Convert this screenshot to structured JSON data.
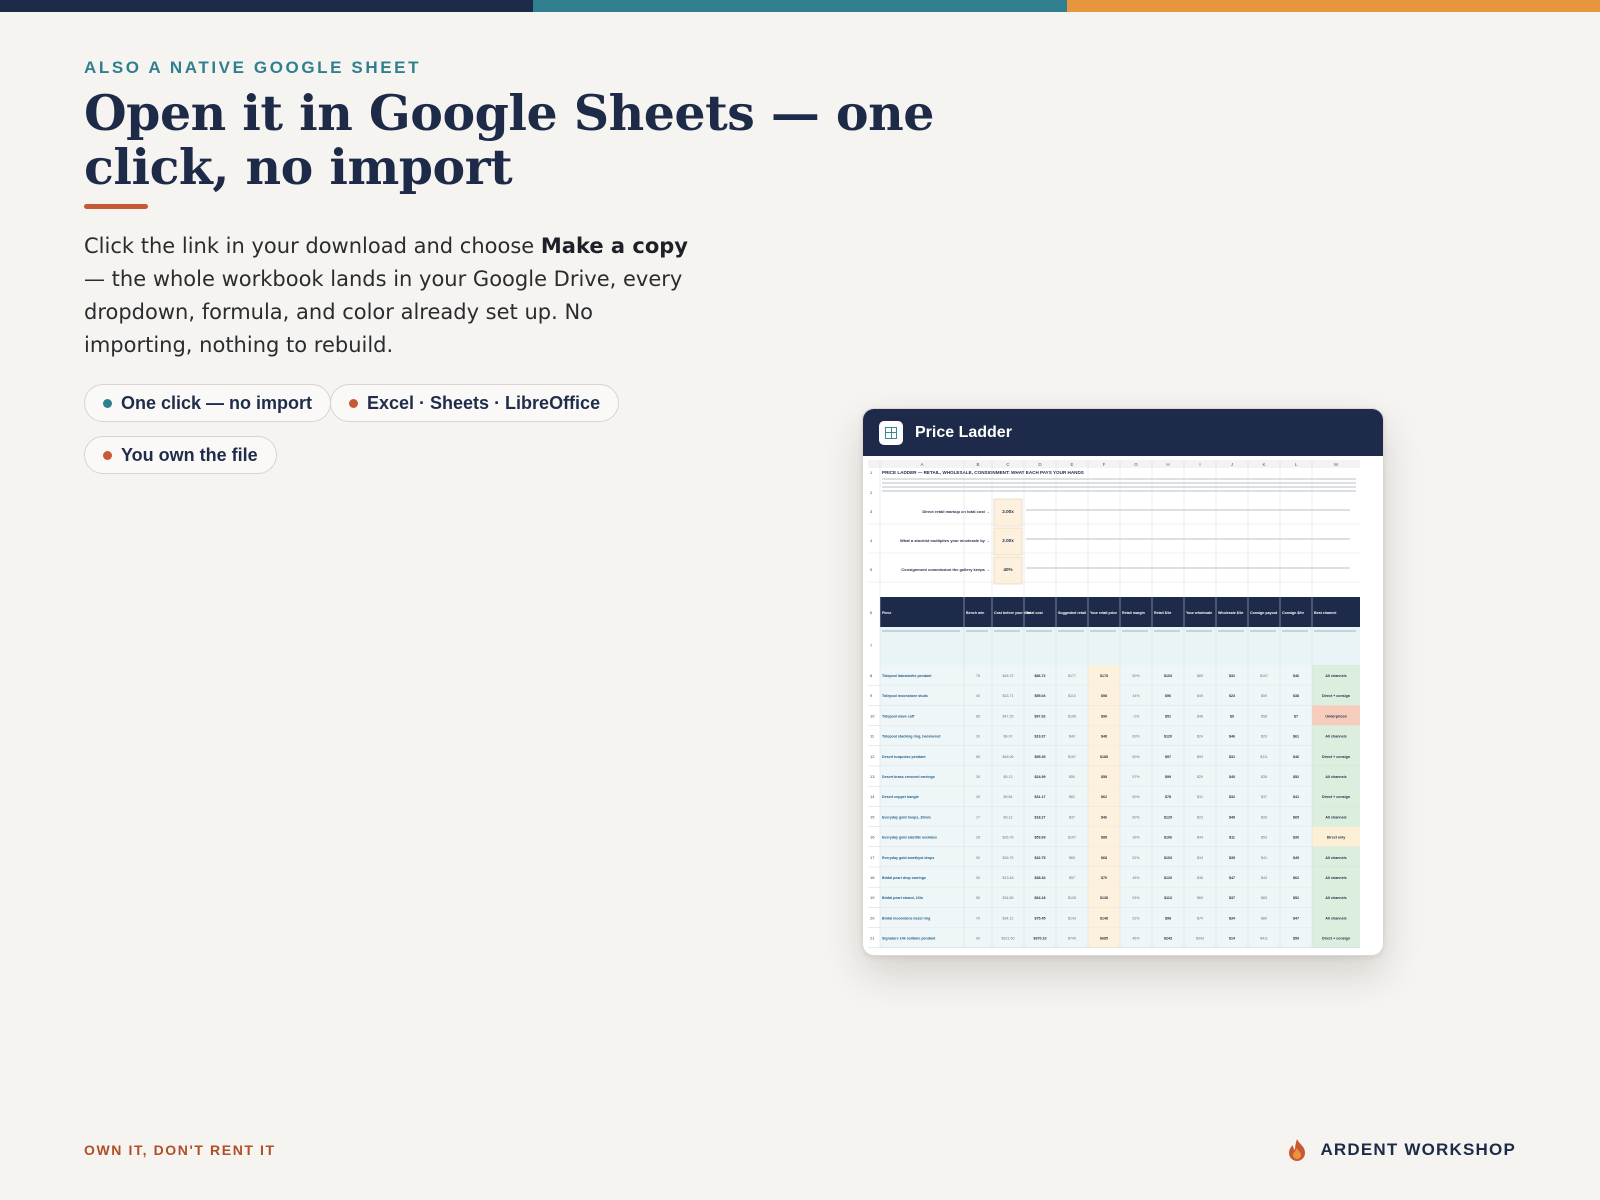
{
  "brand_colors": {
    "navy": "#1e2a4a",
    "teal": "#2f7f8f",
    "orange": "#e8963d",
    "rust": "#c65a35"
  },
  "eyebrow": "ALSO A NATIVE GOOGLE SHEET",
  "headline": "Open it in Google Sheets — one click, no import",
  "body": {
    "part1": "Click the link in your download and choose ",
    "bold": "Make a copy",
    "part2": " — the whole workbook lands in your Google Drive, every dropdown, formula, and color already set up. No importing, nothing to rebuild."
  },
  "pills": [
    {
      "label": "One click — no import",
      "dot_color": "#2f7f8f"
    },
    {
      "label": "Excel · Sheets · LibreOffice",
      "dot_color": "#c65a35"
    },
    {
      "label": "You own the file",
      "dot_color": "#c65a35"
    }
  ],
  "preview": {
    "title": "Price Ladder",
    "icon": "spreadsheet-icon",
    "columns": [
      "A",
      "B",
      "C",
      "D",
      "E",
      "F",
      "G",
      "H",
      "I",
      "J",
      "K",
      "L",
      "M"
    ],
    "sheet_title": "PRICE LADDER — RETAIL, WHOLESALE, CONSIGNMENT: WHAT EACH PAYS YOUR HANDS",
    "settings": [
      {
        "row": "3",
        "label": "Direct retail markup on total cost →",
        "value": "2.00x"
      },
      {
        "row": "4",
        "label": "What a stockist multiplies your wholesale by →",
        "value": "2.00x"
      },
      {
        "row": "5",
        "label": "Consignment commission the gallery keeps →",
        "value": "40%"
      }
    ],
    "headers": [
      "Piece",
      "Bench min",
      "Cost before your time",
      "Total cost",
      "Suggested retail",
      "Your retail price",
      "Retail margin",
      "Retail $/hr",
      "Your wholesale",
      "Wholesale $/hr",
      "Consign payout",
      "Consign $/hr",
      "Best channel"
    ],
    "rows": [
      {
        "n": "8",
        "cells": [
          "Tidepool labradorite pendant",
          "75",
          "$48.72",
          "$86.72",
          "$177",
          "$178",
          "50%",
          "$103",
          "$89",
          "$32",
          "$107",
          "$46",
          "All channels"
        ],
        "status": "good"
      },
      {
        "n": "9",
        "cells": [
          "Tidepool moonstone studs",
          "40",
          "$33.71",
          "$55.04",
          "$110",
          "$98",
          "44%",
          "$96",
          "$49",
          "$23",
          "$59",
          "$38",
          "Direct + consign"
        ],
        "status": "good"
      },
      {
        "n": "10",
        "cells": [
          "Tidepool wave cuff",
          "85",
          "$47.25",
          "$97.92",
          "$196",
          "$96",
          "-2%",
          "$51",
          "$48",
          "$0",
          "$58",
          "$7",
          "Underpriced"
        ],
        "status": "bad"
      },
      {
        "n": "11",
        "cells": [
          "Tidepool stacking ring, hammered",
          "30",
          "$9.97",
          "$19.37",
          "$49",
          "$48",
          "60%",
          "$120",
          "$24",
          "$46",
          "$29",
          "$61",
          "All channels"
        ],
        "status": "good"
      },
      {
        "n": "12",
        "cells": [
          "Desert turquoise pendant",
          "85",
          "$48.06",
          "$95.39",
          "$187",
          "$185",
          "50%",
          "$97",
          "$93",
          "$31",
          "$111",
          "$46",
          "Direct + consign"
        ],
        "status": "good"
      },
      {
        "n": "13",
        "cells": [
          "Desert brass crescent earrings",
          "30",
          "$9.13",
          "$24.99",
          "$50",
          "$58",
          "57%",
          "$99",
          "$29",
          "$40",
          "$35",
          "$52",
          "All channels"
        ],
        "status": "good"
      },
      {
        "n": "14",
        "cells": [
          "Desert copper bangle",
          "40",
          "$9.84",
          "$31.17",
          "$62",
          "$62",
          "50%",
          "$78",
          "$31",
          "$32",
          "$37",
          "$41",
          "Direct + consign"
        ],
        "status": "good"
      },
      {
        "n": "15",
        "cells": [
          "Everyday gold hoops, 20mm",
          "17",
          "$9.12",
          "$18.27",
          "$37",
          "$46",
          "60%",
          "$129",
          "$23",
          "$49",
          "$28",
          "$65",
          "All channels"
        ],
        "status": "good"
      },
      {
        "n": "16",
        "cells": [
          "Everyday gold satellite necklace",
          "28",
          "$36.76",
          "$53.69",
          "$107",
          "$88",
          "39%",
          "$106",
          "$44",
          "$11",
          "$53",
          "$30",
          "Direct only"
        ],
        "status": "warn"
      },
      {
        "n": "17",
        "cells": [
          "Everyday gold amethyst drops",
          "30",
          "$26.75",
          "$32.75",
          "$65",
          "$68",
          "52%",
          "$103",
          "$34",
          "$35",
          "$41",
          "$49",
          "All channels"
        ],
        "status": "good"
      },
      {
        "n": "18",
        "cells": [
          "Bridal pearl drop earrings",
          "30",
          "$13.48",
          "$38.34",
          "$57",
          "$70",
          "45%",
          "$120",
          "$36",
          "$47",
          "$43",
          "$62",
          "All channels"
        ],
        "status": "good"
      },
      {
        "n": "19",
        "cells": [
          "Bridal pearl strand, 16in",
          "55",
          "$34.85",
          "$64.18",
          "$128",
          "$138",
          "53%",
          "$113",
          "$69",
          "$37",
          "$83",
          "$52",
          "All channels"
        ],
        "status": "good"
      },
      {
        "n": "20",
        "cells": [
          "Bridal moonstone bezel ring",
          "70",
          "$34.12",
          "$75.45",
          "$143",
          "$148",
          "52%",
          "$98",
          "$74",
          "$34",
          "$89",
          "$47",
          "All channels"
        ],
        "status": "good"
      },
      {
        "n": "21",
        "cells": [
          "Signature 14k solitaire pendant",
          "90",
          "$321.50",
          "$370.10",
          "$740",
          "$685",
          "46%",
          "$243",
          "$343",
          "$14",
          "$411",
          "$59",
          "Direct + consign"
        ],
        "status": "good"
      }
    ]
  },
  "footer": {
    "tagline": "OWN IT, DON'T RENT IT",
    "brand": "ARDENT WORKSHOP",
    "brand_icon": "flame-icon"
  }
}
